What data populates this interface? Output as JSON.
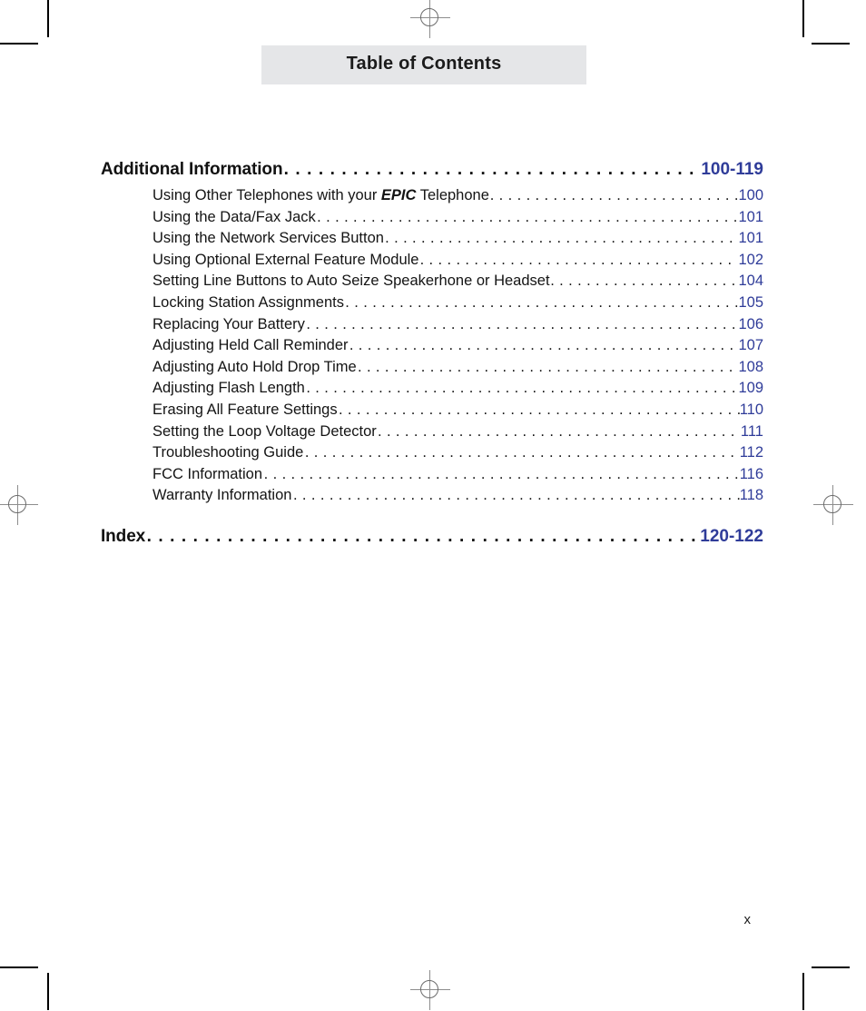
{
  "page": {
    "running_head": "Table of Contents",
    "folio": "x",
    "accent_color": "#2f3c99",
    "head_band_color": "#e5e6e8",
    "text_color": "#141414"
  },
  "marks": {
    "registration_icon": "registration-target",
    "crop_icon": "crop-mark"
  },
  "toc": {
    "sections": [
      {
        "label": "Additional Information",
        "page": "100-119",
        "entries": [
          {
            "pre": "Using Other Telephones with your ",
            "emphasis": "EPIC",
            "post": " Telephone",
            "page": "100"
          },
          {
            "pre": "Using the Data/Fax Jack",
            "emphasis": "",
            "post": "",
            "page": "101"
          },
          {
            "pre": "Using the Network Services Button",
            "emphasis": "",
            "post": "",
            "page": "101"
          },
          {
            "pre": "Using Optional External Feature Module",
            "emphasis": "",
            "post": "",
            "page": "102"
          },
          {
            "pre": "Setting Line Buttons to Auto Seize Speakerhone or Headset",
            "emphasis": "",
            "post": "",
            "page": "104"
          },
          {
            "pre": "Locking Station Assignments",
            "emphasis": "",
            "post": "",
            "page": "105"
          },
          {
            "pre": "Replacing Your Battery",
            "emphasis": "",
            "post": "",
            "page": "106"
          },
          {
            "pre": "Adjusting Held Call Reminder",
            "emphasis": "",
            "post": "",
            "page": "107"
          },
          {
            "pre": "Adjusting Auto Hold Drop Time",
            "emphasis": "",
            "post": "",
            "page": "108"
          },
          {
            "pre": "Adjusting Flash Length",
            "emphasis": "",
            "post": "",
            "page": "109"
          },
          {
            "pre": "Erasing All Feature Settings",
            "emphasis": "",
            "post": "",
            "page": "110"
          },
          {
            "pre": "Setting the Loop Voltage Detector",
            "emphasis": "",
            "post": "",
            "page": "111"
          },
          {
            "pre": "Troubleshooting Guide",
            "emphasis": "",
            "post": "",
            "page": "112"
          },
          {
            "pre": "FCC Information",
            "emphasis": "",
            "post": "",
            "page": "116"
          },
          {
            "pre": "Warranty Information",
            "emphasis": "",
            "post": "",
            "page": "118"
          }
        ]
      },
      {
        "label": "Index",
        "page": "120-122",
        "entries": []
      }
    ]
  }
}
